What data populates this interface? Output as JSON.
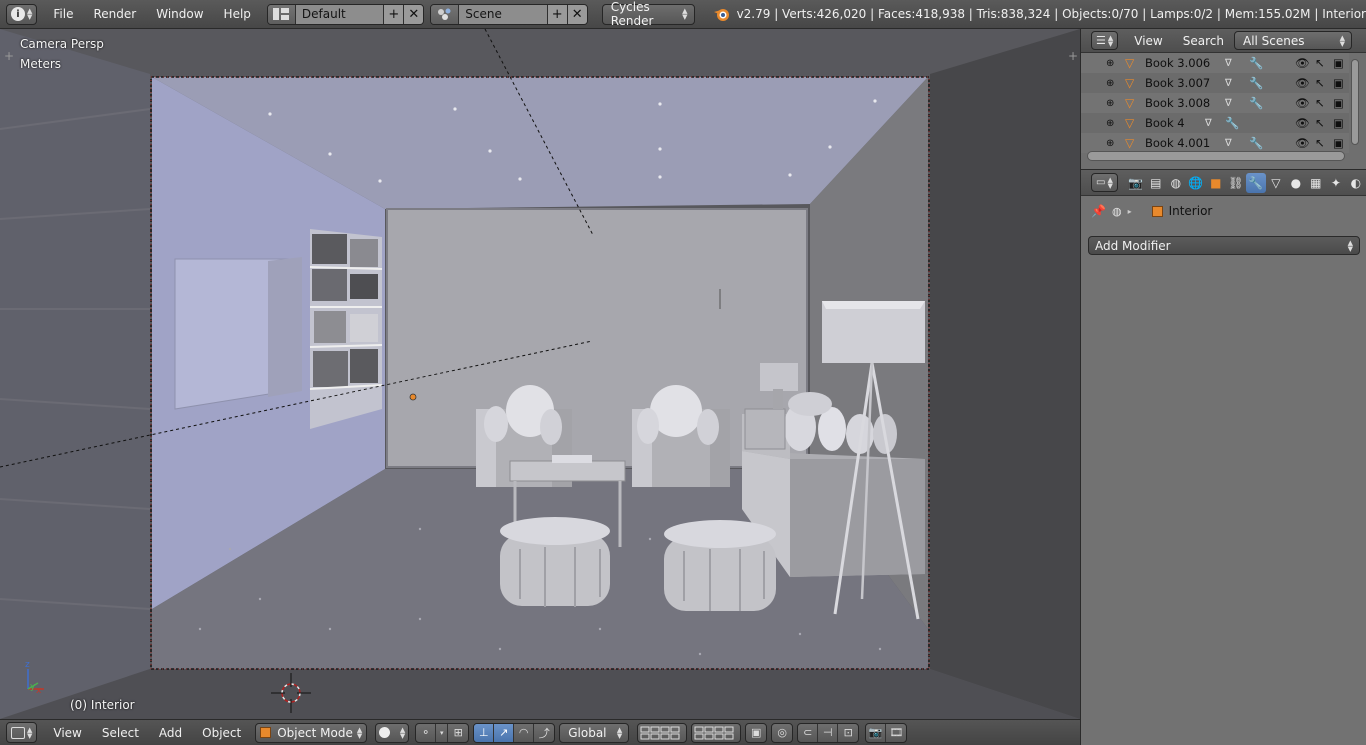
{
  "topbar": {
    "menus": [
      "File",
      "Render",
      "Window",
      "Help"
    ],
    "screen_layout": "Default",
    "scene": "Scene",
    "render_engine": "Cycles Render",
    "stats": "v2.79 | Verts:426,020 | Faces:418,938 | Tris:838,324 | Objects:0/70 | Lamps:0/2 | Mem:155.02M | Interior"
  },
  "viewport": {
    "view_name": "Camera Persp",
    "units": "Meters",
    "active_object": "(0) Interior"
  },
  "bottombar": {
    "menus": [
      "View",
      "Select",
      "Add",
      "Object"
    ],
    "mode": "Object Mode",
    "orientation": "Global"
  },
  "outliner": {
    "menus": [
      "View",
      "Search"
    ],
    "display_mode": "All Scenes",
    "items": [
      {
        "label": "Book 3.006"
      },
      {
        "label": "Book 3.007"
      },
      {
        "label": "Book 3.008"
      },
      {
        "label": "Book 4"
      },
      {
        "label": "Book 4.001"
      }
    ]
  },
  "properties": {
    "context_object": "Interior",
    "add_modifier": "Add Modifier"
  },
  "colors": {
    "accent_blue": "#5680c2",
    "object_orange": "#e8892c",
    "camera_border": "#b03030"
  }
}
